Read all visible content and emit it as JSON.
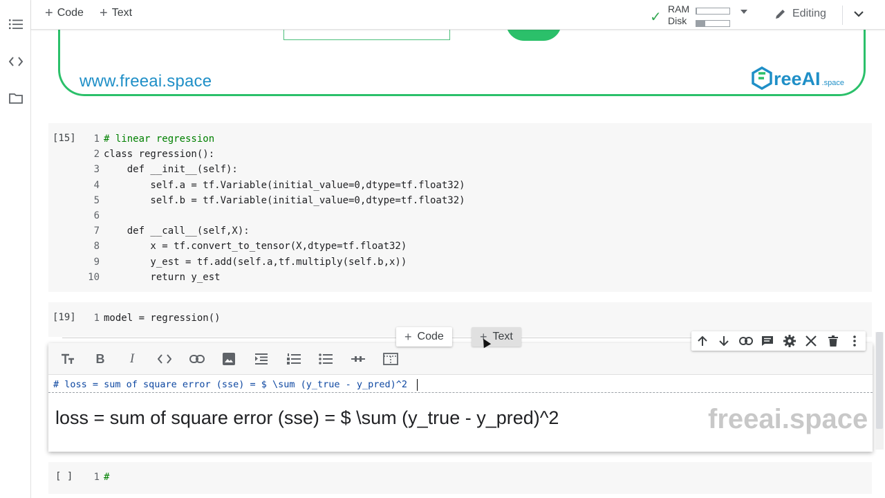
{
  "toolbar": {
    "add_code_label": "Code",
    "add_text_label": "Text",
    "ram_label": "RAM",
    "disk_label": "Disk",
    "ram_usage": 0.02,
    "disk_usage": 0.28,
    "editing_label": "Editing"
  },
  "banner": {
    "site_url": "www.freeai.space",
    "logo_main": "reeAI",
    "logo_sub": ".space"
  },
  "cells": [
    {
      "exec_count": "[15]",
      "lines": [
        "# linear regression",
        "class regression():",
        "    def __init__(self):",
        "        self.a = tf.Variable(initial_value=0,dtype=tf.float32)",
        "        self.b = tf.Variable(initial_value=0,dtype=tf.float32)",
        "",
        "    def __call__(self,X):",
        "        x = tf.convert_to_tensor(X,dtype=tf.float32)",
        "        y_est = tf.add(self.a,tf.multiply(self.b,x))",
        "        return y_est"
      ]
    },
    {
      "exec_count": "[19]",
      "lines": [
        "model = regression()"
      ]
    },
    {
      "exec_count": "[ ]",
      "lines": [
        "#"
      ]
    }
  ],
  "insert_bar": {
    "code_label": "Code",
    "text_label": "Text"
  },
  "text_cell": {
    "source": "# loss = sum of square error (sse) = $ \\sum (y_true - y_pred)^2 ",
    "rendered": "loss = sum of square error (sse) = $ \\sum (y_true - y_pred)^2",
    "watermark": "freeai.space"
  },
  "line_numbers": [
    "1",
    "2",
    "3",
    "4",
    "5",
    "6",
    "7",
    "8",
    "9",
    "10"
  ],
  "colors": {
    "accent_green": "#2bc06a",
    "brand_blue": "#1f8fc7",
    "check_green": "#34a853"
  }
}
